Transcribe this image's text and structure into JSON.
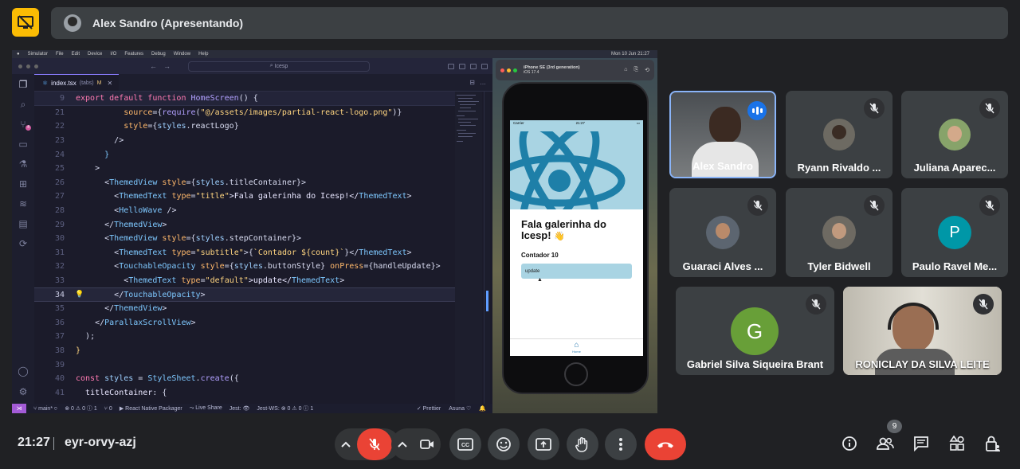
{
  "presenting": {
    "label": "Alex Sandro (Apresentando)"
  },
  "mac_menu": {
    "items": [
      "Simulator",
      "File",
      "Edit",
      "Device",
      "I/O",
      "Features",
      "Debug",
      "Window",
      "Help"
    ],
    "clock": "Mon 10 Jun 21:27"
  },
  "vscode": {
    "search": "Icesp",
    "tab": {
      "name": "index.tsx",
      "hint": "(tabs)",
      "modified": "M"
    },
    "lines": [
      {
        "n": "9",
        "sticky": true
      },
      {
        "n": "21"
      },
      {
        "n": "22"
      },
      {
        "n": "23"
      },
      {
        "n": "24"
      },
      {
        "n": "25"
      },
      {
        "n": "26"
      },
      {
        "n": "27"
      },
      {
        "n": "28"
      },
      {
        "n": "29"
      },
      {
        "n": "30"
      },
      {
        "n": "31"
      },
      {
        "n": "32"
      },
      {
        "n": "33"
      },
      {
        "n": "34"
      },
      {
        "n": "35"
      },
      {
        "n": "36"
      },
      {
        "n": "37"
      },
      {
        "n": "38"
      },
      {
        "n": "39"
      },
      {
        "n": "40"
      },
      {
        "n": "41"
      }
    ],
    "status": {
      "branch": "main*",
      "errors": "⊗ 0 ⚠ 0 ⓘ 1",
      "ports": "⑂ 0",
      "packager": "React Native Packager",
      "live_share": "Live Share",
      "jest": "Jest:",
      "jest_ws": "Jest-WS: ⊗ 0 ⚠ 0 ⓘ 1",
      "prettier": "✓ Prettier",
      "theme": "Asuna"
    }
  },
  "simulator": {
    "title": "iPhone SE (3rd generation)",
    "subtitle": "iOS 17.4",
    "carrier": "Carrier",
    "time": "21:27",
    "app_title": "Fala galerinha do Icesp!",
    "wave": "👋",
    "counter": "Contador 10",
    "button": "update",
    "tab_label": "Home"
  },
  "participants": [
    {
      "name": "Alex Sandro",
      "speaking": true
    },
    {
      "name": "Ryann Rivaldo ..."
    },
    {
      "name": "Juliana Aparec..."
    },
    {
      "name": "Guaraci Alves ..."
    },
    {
      "name": "Tyler Bidwell"
    },
    {
      "name": "Paulo Ravel Me...",
      "initial": "P",
      "color": "#0097a7"
    },
    {
      "name": "Gabriel Silva Siqueira Brant",
      "initial": "G",
      "color": "#689f38"
    },
    {
      "name": "RONICLAY DA SILVA LEITE"
    }
  ],
  "bottom": {
    "time": "21:27",
    "meeting_code": "eyr-orvy-azj",
    "people_count": "9",
    "danger_color": "#ea4335"
  }
}
